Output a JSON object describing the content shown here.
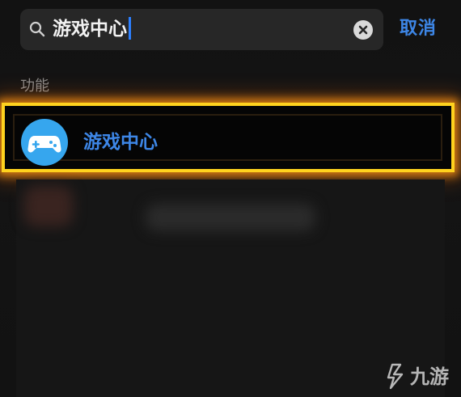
{
  "search": {
    "query": "游戏中心",
    "cancel_label": "取消"
  },
  "section": {
    "title": "功能"
  },
  "results": [
    {
      "label": "游戏中心",
      "icon": "gamepad-icon"
    }
  ],
  "watermark": {
    "text": "九游",
    "icon": "jiuyou-logo-icon"
  },
  "colors": {
    "accent": "#3d86e6",
    "highlight": "#ffd21e",
    "icon_bg": "#36a6ee"
  }
}
